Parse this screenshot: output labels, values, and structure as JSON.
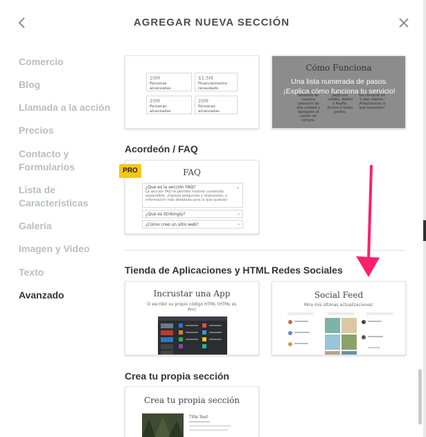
{
  "header": {
    "title": "AGREGAR NUEVA SECCIÓN"
  },
  "sidebar": {
    "items": [
      {
        "label": "Comercio"
      },
      {
        "label": "Blog"
      },
      {
        "label": "Llamada a la acción"
      },
      {
        "label": "Precios"
      },
      {
        "label": "Contacto y Formularios"
      },
      {
        "label": "Lista de Características"
      },
      {
        "label": "Galería"
      },
      {
        "label": "Imagen y Video"
      },
      {
        "label": "Texto"
      },
      {
        "label": "Avanzado"
      }
    ],
    "active": "Avanzado"
  },
  "stats_card": {
    "boxes": [
      {
        "num": "20M",
        "text": "Personas alcanzadas"
      },
      {
        "num": "$1.5M",
        "text": "Financiamiento recaudado"
      },
      {
        "num": "20M",
        "text": "Personas alcanzadas"
      },
      {
        "num": "20M",
        "text": "Personas alcanzadas"
      }
    ]
  },
  "como_card": {
    "title": "Cómo Funciona",
    "overlay": "Una lista numerada de pasos. ¡Explica cómo funciona tu servicio!",
    "cols": [
      "favoritos de nuestra colección de alta calidad y agrégalos al carrito de compra.",
      "pago con crédito, débito o PayPal. Envíos a todas partes.",
      "tus compras en 5 días hábiles. ¡Pregúntanos lo que necesites!"
    ]
  },
  "faq_section": {
    "heading": "Acordeón / FAQ",
    "badge": "PRO",
    "title": "FAQ",
    "rows": [
      {
        "q": "¿Que es la sección FAQ?",
        "a": "La sección FAQ te permite mostrar contenido expandible. ¡Ingresa preguntas y respuestas, o información más detallada para lo que quieras!",
        "chev": "⌄"
      },
      {
        "q": "¿Qué es Strikingly?",
        "chev": "›"
      },
      {
        "q": "¿Cómo creo un sitio web?",
        "chev": "›"
      }
    ]
  },
  "apps_section": {
    "heading": "Tienda de Aplicaciones y HTML",
    "title": "Incrustar una App",
    "subtitle": "O escribir su propio código HTML (HTML es Pro)"
  },
  "social_section": {
    "heading": "Redes Sociales",
    "title": "Social Feed",
    "subtitle": "Mira mis últimas actualizaciones!"
  },
  "custom_section": {
    "heading": "Crea tu propia sección",
    "title": "Crea tu propia sección",
    "snippet": "Title Text"
  },
  "colors": {
    "accent_arrow": "#ff1f6b",
    "pro_badge": "#f5c518",
    "sidebar_muted": "#b7bec2"
  }
}
